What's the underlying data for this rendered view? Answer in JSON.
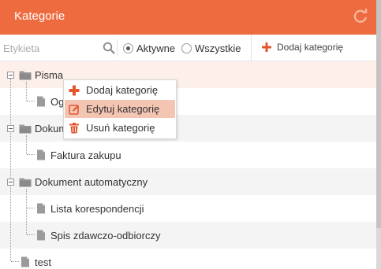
{
  "header": {
    "title": "Kategorie",
    "refresh_icon": "refresh-icon"
  },
  "toolbar": {
    "search": {
      "placeholder": "Etykieta",
      "value": ""
    },
    "filter": {
      "options": [
        "Aktywne",
        "Wszystkie"
      ],
      "selected": "Aktywne"
    },
    "add_label": "Dodaj kategorię"
  },
  "tree": {
    "nodes": [
      {
        "label": "Pisma"
      },
      {
        "label": "Og"
      },
      {
        "label": "Dokum"
      },
      {
        "label": "Faktura zakupu"
      },
      {
        "label": "Dokument automatyczny"
      },
      {
        "label": "Lista korespondencji"
      },
      {
        "label": "Spis zdawczo-odbiorczy"
      },
      {
        "label": "test"
      }
    ]
  },
  "context_menu": {
    "items": [
      {
        "label": "Dodaj kategorię",
        "icon": "plus-icon"
      },
      {
        "label": "Edytuj kategorię",
        "icon": "edit-icon",
        "active": true
      },
      {
        "label": "Usuń kategorię",
        "icon": "trash-icon"
      }
    ]
  },
  "colors": {
    "accent": "#ee6b40",
    "highlight_row": "#fdefe9",
    "menu_active": "#f4c5b3"
  }
}
